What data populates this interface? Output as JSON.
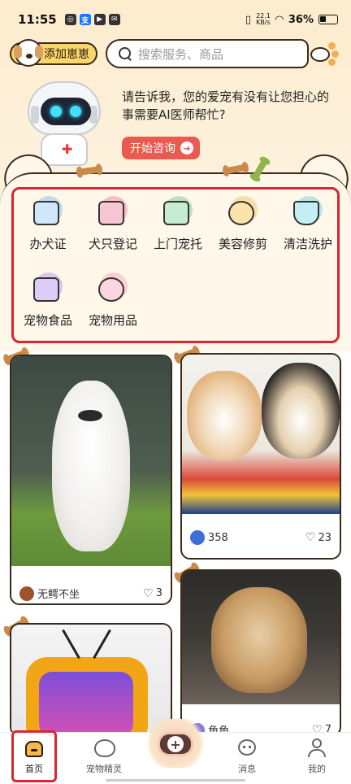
{
  "status_bar": {
    "time": "11:55",
    "net_speed_value": "22.1",
    "net_speed_unit": "KB/s",
    "battery": "36%"
  },
  "header": {
    "add_pet_label": "添加崽崽",
    "search_placeholder": "搜索服务、商品"
  },
  "ai_banner": {
    "prompt": "请告诉我，您的爱宠有没有让您担心的事需要AI医师帮忙?",
    "button_label": "开始咨询"
  },
  "services": [
    {
      "label": "办犬证",
      "icon": "dog-license-icon",
      "color": "#4fa8e8"
    },
    {
      "label": "犬只登记",
      "icon": "dog-registration-icon",
      "color": "#e85a7a"
    },
    {
      "label": "上门宠托",
      "icon": "pet-boarding-icon",
      "color": "#3fb96b"
    },
    {
      "label": "美容修剪",
      "icon": "scissors-icon",
      "color": "#f0b030"
    },
    {
      "label": "清洁洗护",
      "icon": "bathtub-icon",
      "color": "#3ec6d8"
    },
    {
      "label": "宠物食品",
      "icon": "pet-food-icon",
      "color": "#9a6ae0"
    },
    {
      "label": "宠物用品",
      "icon": "pet-supplies-icon",
      "color": "#f08aa0"
    }
  ],
  "feed": [
    {
      "author": "无鳄不坐",
      "likes": "3"
    },
    {
      "author": "358",
      "likes": "23"
    },
    {
      "author": "",
      "likes": ""
    },
    {
      "author": "角角",
      "likes": "7"
    }
  ],
  "bottom_nav": {
    "home": "首页",
    "pet_spirit": "宠物精灵",
    "messages": "消息",
    "mine": "我的"
  }
}
